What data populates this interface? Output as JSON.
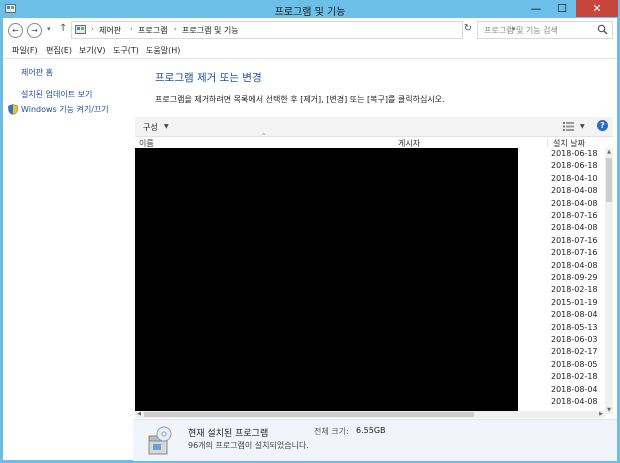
{
  "window": {
    "title": "프로그램 및 기능",
    "minimize": "—",
    "maximize": "☐",
    "close": "✕"
  },
  "address": {
    "crumbs": [
      "제어판",
      "프로그램",
      "프로그램 및 기능"
    ],
    "search_placeholder": "프로그램 및 기능 검색"
  },
  "menu": [
    "파일(F)",
    "편집(E)",
    "보기(V)",
    "도구(T)",
    "도움말(H)"
  ],
  "sidebar": {
    "home": "제어판 홈",
    "installed_updates": "설치된 업데이트 보기",
    "windows_features": "Windows 기능 켜기/끄기"
  },
  "main": {
    "title": "프로그램 제거 또는 변경",
    "description": "프로그램을 제거하려면 목록에서 선택한 후 [제거], [변경] 또는 [복구]를 클릭하십시오."
  },
  "toolbar": {
    "organize": "구성"
  },
  "columns": {
    "name": "이름",
    "publisher": "게시자",
    "installed_on": "설치 날짜"
  },
  "install_dates": [
    "2018-06-18",
    "2018-06-18",
    "2018-04-10",
    "2018-04-08",
    "2018-04-08",
    "2018-07-16",
    "2018-04-08",
    "2018-07-16",
    "2018-07-16",
    "2018-04-08",
    "2018-09-29",
    "2018-02-18",
    "2015-01-19",
    "2018-08-04",
    "2018-05-13",
    "2018-06-03",
    "2018-02-17",
    "2018-08-05",
    "2018-02-18",
    "2018-08-04",
    "2018-04-08"
  ],
  "details": {
    "title": "현재 설치된 프로그램",
    "size_label": "전체 크기:",
    "size_value": "6.55GB",
    "count_text": "96개의 프로그램이 설치되었습니다."
  },
  "colors": {
    "accent_title": "#1f4fa0",
    "link": "#1c4fa0",
    "frame": "#6cc0e8",
    "close_button": "#c7463b"
  }
}
